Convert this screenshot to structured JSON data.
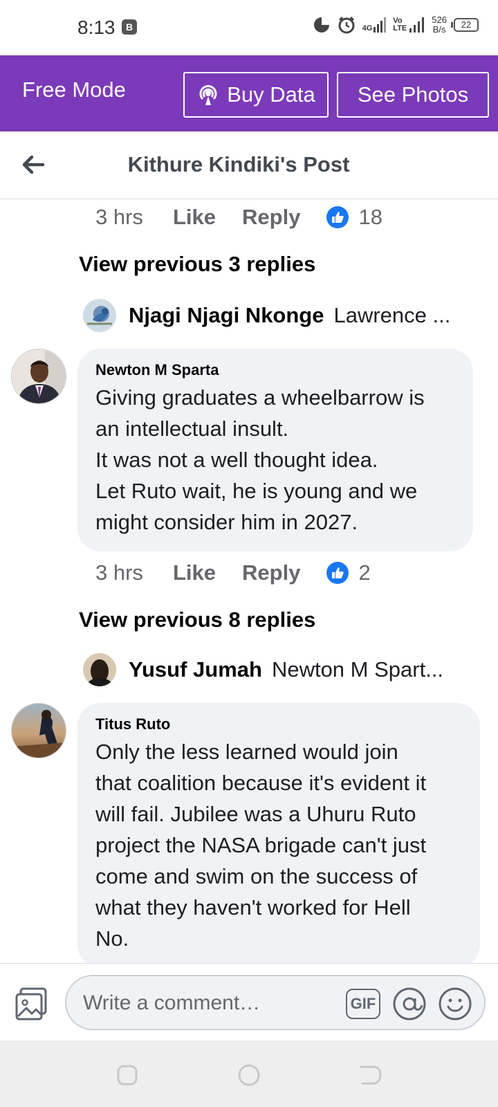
{
  "status_bar": {
    "time": "8:13",
    "badge": "B",
    "network_label": "4G",
    "volte_label": "Vo LTE",
    "speed_value": "526",
    "speed_unit": "B/s",
    "battery": "22"
  },
  "free_mode_bar": {
    "label": "Free Mode",
    "buy_data": "Buy Data",
    "see_photos": "See Photos",
    "color": "#7b3ab9"
  },
  "header": {
    "title": "Kithure Kindiki's Post"
  },
  "thread": {
    "top_meta": {
      "time": "3 hrs",
      "like": "Like",
      "reply": "Reply",
      "reactions": "18"
    },
    "view_prev_1": "View previous 3 replies",
    "reply_preview_1": {
      "name": "Njagi Njagi Nkonge",
      "text": "Lawrence ..."
    },
    "comment_1": {
      "author": "Newton M Sparta",
      "lines": [
        "Giving graduates a wheelbarrow is",
        "an intellectual insult.",
        "It was not a well thought idea.",
        "Let Ruto wait, he is young and we",
        "might consider him in 2027."
      ]
    },
    "meta_1": {
      "time": "3 hrs",
      "like": "Like",
      "reply": "Reply",
      "reactions": "2"
    },
    "view_prev_2": "View previous 8 replies",
    "reply_preview_2": {
      "name": "Yusuf Jumah",
      "text": "Newton M Spart..."
    },
    "comment_2": {
      "author": "Titus Ruto",
      "lines": [
        "Only the less learned would join",
        "that coalition because it's evident it",
        "will fail. Jubilee was a Uhuru Ruto",
        "project the NASA brigade can't just",
        "come and swim on the success of",
        "what they haven't worked for Hell",
        "No."
      ]
    }
  },
  "composer": {
    "placeholder": "Write a comment…",
    "gif_label": "GIF"
  },
  "colors": {
    "like_blue": "#1877f2",
    "bubble_bg": "#f0f2f5",
    "meta_gray": "#65676b"
  }
}
